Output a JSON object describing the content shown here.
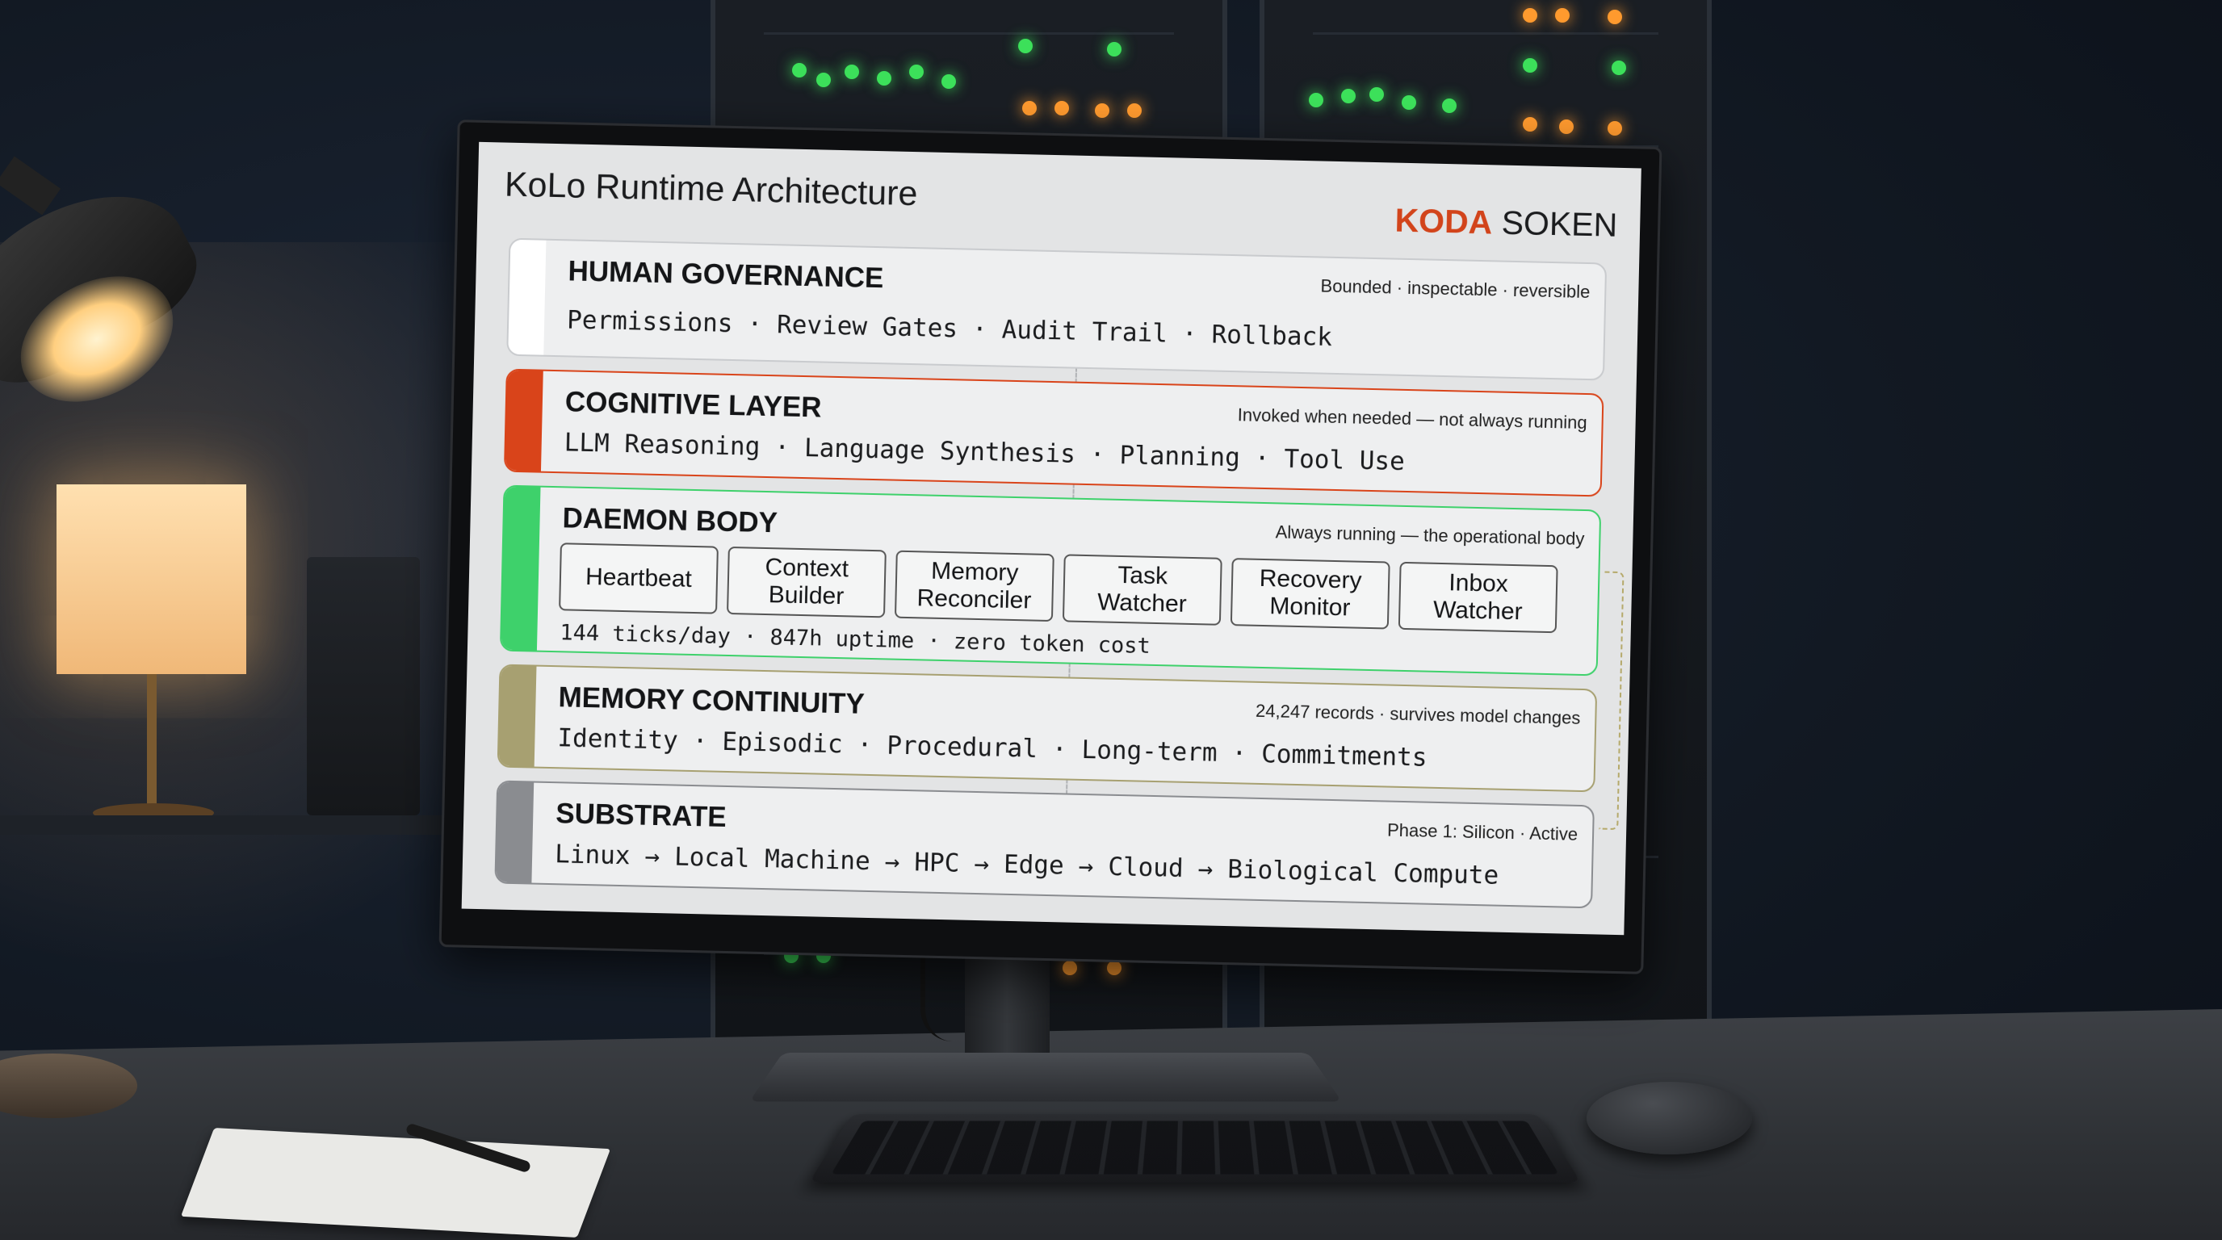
{
  "screen": {
    "title": "KoLo Runtime Architecture",
    "brand": {
      "primary": "KODA",
      "secondary": "SOKEN",
      "primary_color": "#d2441b"
    }
  },
  "layers": [
    {
      "name": "HUMAN GOVERNANCE",
      "note": "Bounded · inspectable · reversible",
      "accent": "#ffffff",
      "items": [
        "Permissions",
        "Review Gates",
        "Audit Trail",
        "Rollback"
      ]
    },
    {
      "name": "COGNITIVE LAYER",
      "note": "Invoked when needed — not always running",
      "accent": "#d9441a",
      "items": [
        "LLM Reasoning",
        "Language Synthesis",
        "Planning",
        "Tool Use"
      ]
    },
    {
      "name": "DAEMON BODY",
      "note": "Always running — the operational body",
      "accent": "#3ed16b",
      "modules": [
        "Heartbeat",
        "Context Builder",
        "Memory Reconciler",
        "Task Watcher",
        "Recovery Monitor",
        "Inbox Watcher"
      ],
      "stats": "144 ticks/day · 847h uptime · zero token cost"
    },
    {
      "name": "MEMORY CONTINUITY",
      "note": "24,247 records · survives model changes",
      "accent": "#a7a071",
      "items": [
        "Identity",
        "Episodic",
        "Procedural",
        "Long-term",
        "Commitments"
      ]
    },
    {
      "name": "SUBSTRATE",
      "note": "Phase 1: Silicon · Active",
      "accent": "#8a8c90",
      "chain": [
        "Linux",
        "Local Machine",
        "HPC",
        "Edge",
        "Cloud",
        "Biological Compute"
      ]
    }
  ],
  "separators": {
    "dot": "·",
    "arrow": "→"
  }
}
